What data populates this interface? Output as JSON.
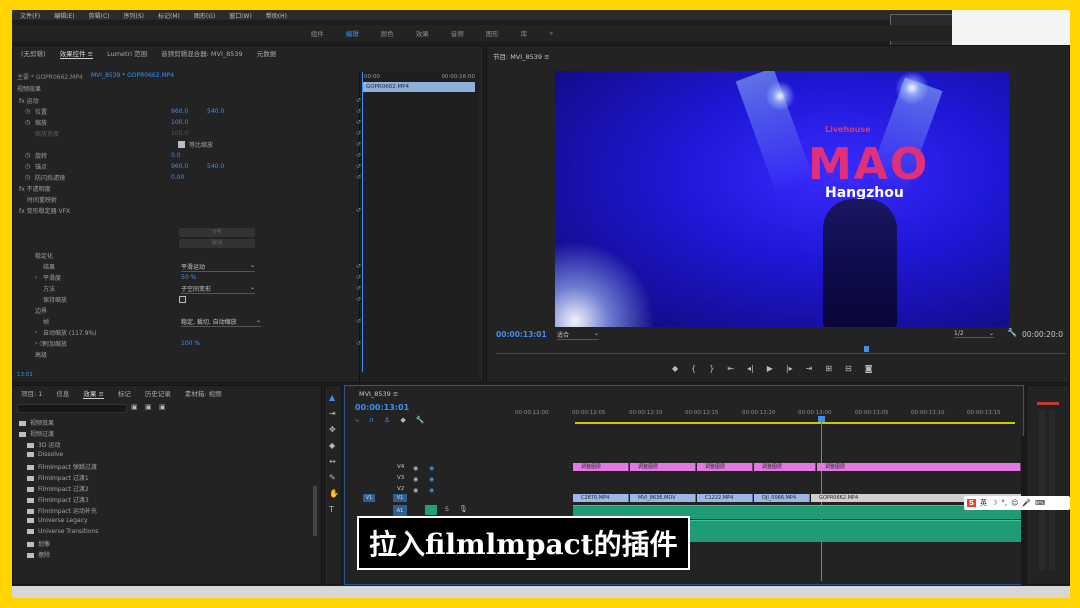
{
  "app": {
    "menus": [
      "文件(F)",
      "编辑(E)",
      "剪辑(C)",
      "序列(S)",
      "标记(M)",
      "图形(G)",
      "窗口(W)",
      "帮助(H)"
    ],
    "workspaces": [
      "组件",
      "编辑",
      "颜色",
      "效果",
      "音频",
      "图形",
      "库",
      "»"
    ],
    "active_workspace": "编辑"
  },
  "effect_controls": {
    "tabs": [
      "(无剪辑)",
      "效果控件 ≡",
      "Lumetri 范围",
      "音频剪辑混合器: MVI_8539",
      "元数据"
    ],
    "source_label": "主要 * GOPR0662.MP4",
    "clip_label": "MVI_8539 * GOPR0662.MP4",
    "section_header": "视频效果",
    "time_start": "00:00",
    "time_end": "00:00:16:00",
    "clip_bar": "GOPR0662.MP4",
    "rows": {
      "motion": "fx  运动",
      "position": "位置",
      "position_x": "960.0",
      "position_y": "540.0",
      "scale": "缩放",
      "scale_val": "100.0",
      "scale_width": "缩放宽度",
      "scale_width_val": "100.0",
      "uniform_scale": "等比缩放",
      "rotation": "旋转",
      "rotation_val": "0.0",
      "anchor": "锚点",
      "anchor_x": "960.0",
      "anchor_y": "540.0",
      "flicker": "防闪烁滤镜",
      "flicker_val": "0.00",
      "opacity": "fx  不透明度",
      "time_remap": "时间重映射",
      "warp": "fx  变形稳定器 VFX",
      "analysis": "分析",
      "cancel": "取消",
      "stabilize": "稳定化",
      "result": "结果",
      "result_val": "平滑运动",
      "smoothness": "平滑度",
      "smoothness_val": "50 %",
      "method": "方法",
      "method_val": "子空间变形",
      "keep_scale": "保持缩放",
      "borders": "边界",
      "framing": "帧",
      "framing_val": "稳定, 裁切, 自动缩放",
      "auto_scale": "自动缩放 (117.9%)",
      "extra_scale": "附加缩放",
      "extra_scale_val": "100 %",
      "advanced": "高级"
    },
    "bottom_time": "13:01"
  },
  "program_monitor": {
    "title": "节目: MVI_8539 ≡",
    "timecode": "00:00:13:01",
    "fit": "适合",
    "ratio": "1/2",
    "duration": "00:00:20:0",
    "video_text": {
      "top": "Livehouse",
      "brand": "MAO",
      "city": "Hangzhou"
    }
  },
  "project_panel": {
    "tabs": [
      "项目: 1",
      "信息",
      "效果 ≡",
      "标记",
      "历史记录",
      "素材箱: 视频"
    ],
    "items": [
      "视频效果",
      "视频过渡",
      "3D 运动",
      "Dissolve",
      "FilmImpact 弹跳过渡",
      "FilmImpact 过渡1",
      "FilmImpact 过渡2",
      "FilmImpact 过渡3",
      "FilmImpact 运动补充",
      "Universe Legacy",
      "Universe Transitions",
      "划像",
      "擦除"
    ]
  },
  "timeline": {
    "tab": "MVI_8539 ≡",
    "timecode": "00:00:13:01",
    "ruler": [
      "00:00:12:00",
      "00:00:12:05",
      "00:00:12:10",
      "00:00:12:15",
      "00:00:12:20",
      "00:00:13:00",
      "00:00:13:05",
      "00:00:13:10",
      "00:00:13:15"
    ],
    "tracks": {
      "v4": "V4",
      "v3": "V3",
      "v2": "V2",
      "v1": "V1",
      "a1": "A1",
      "a2": "A2",
      "src_v1": "V1",
      "src_a1": "A1"
    },
    "v4_clips": [
      "调整图层",
      "调整图层",
      "调整图层",
      "调整图层",
      "调整图层"
    ],
    "v1_clips": [
      "C2870.MP4",
      "MVI_8636.MOV",
      "C1222.MP4",
      "DJI_0066.MP4",
      "GOPR0662.MP4"
    ]
  },
  "subtitle": "拉入filmlmpact的插件",
  "ime": {
    "label": "英"
  }
}
